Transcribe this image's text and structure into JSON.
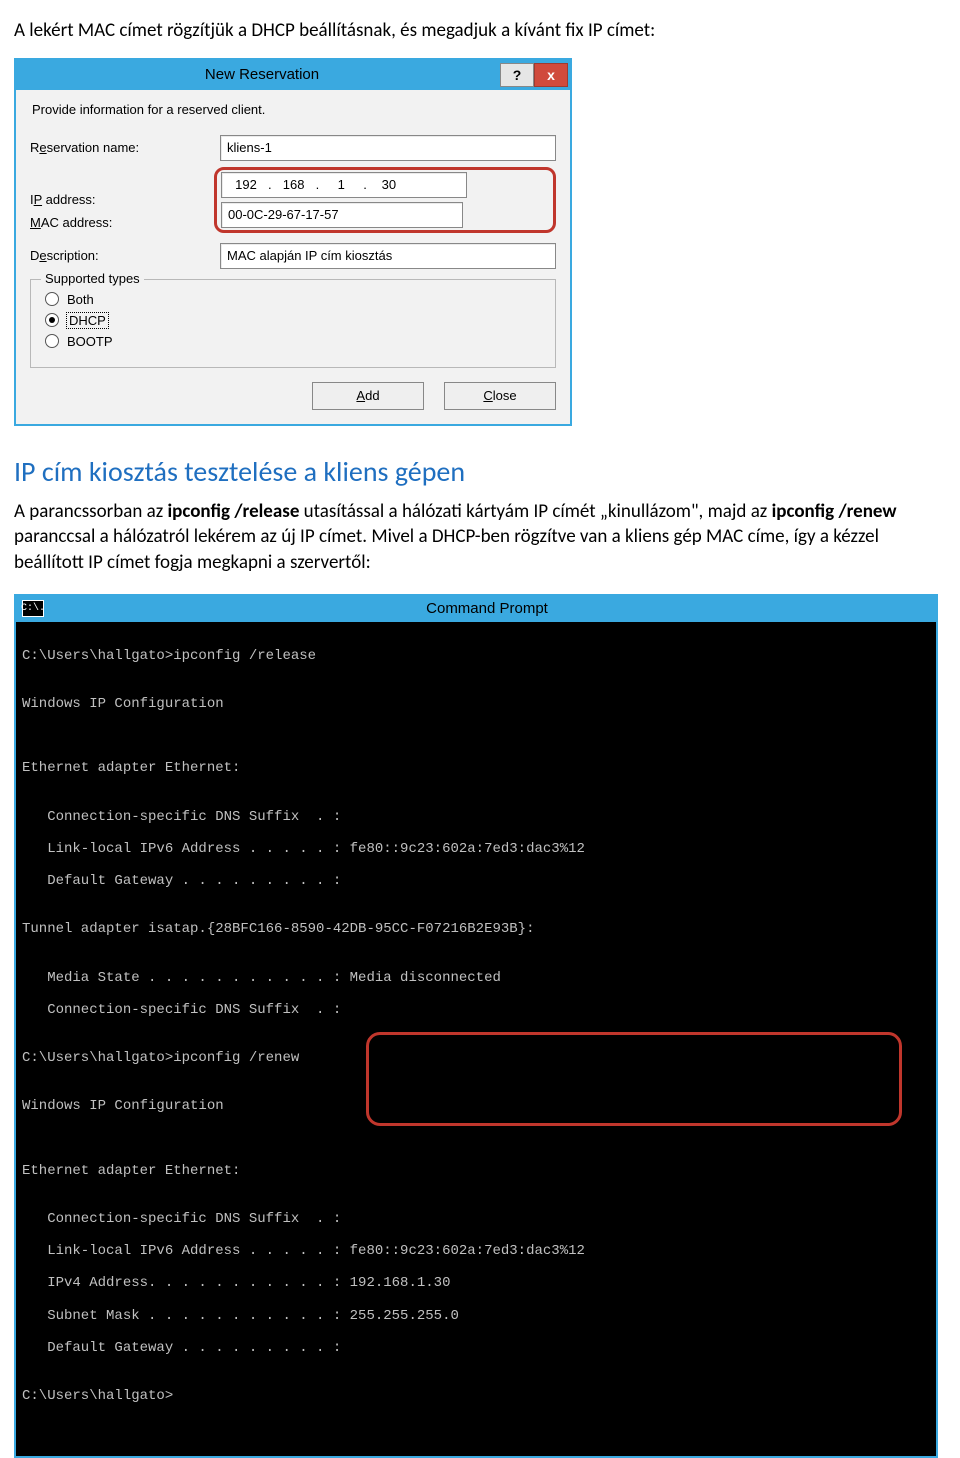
{
  "doc": {
    "intro_line": "A lekért MAC címet rögzítjük a DHCP beállításnak, és megadjuk a kívánt fix IP címet:",
    "heading": "IP cím kiosztás tesztelése a kliens gépen",
    "para_a": "A parancssorban az ",
    "para_b": "ipconfig /release",
    "para_c": " utasítással a hálózati kártyám IP címét „kinullázom\", majd az ",
    "para_d": "ipconfig /renew",
    "para_e": " paranccsal a hálózatról lekérem az új IP címet. Mivel a DHCP-ben rögzítve van a kliens gép MAC címe, így a kézzel beállított IP címet fogja megkapni a szervertől:"
  },
  "dlg": {
    "title": "New Reservation",
    "help": "?",
    "close": "x",
    "intro": "Provide information for a reserved client.",
    "lbl_name_pre": "R",
    "lbl_name_u": "e",
    "lbl_name_post": "servation name:",
    "lbl_ip_pre": "I",
    "lbl_ip_u": "P",
    "lbl_ip_post": " address:",
    "lbl_mac_pre": "",
    "lbl_mac_u": "M",
    "lbl_mac_post": "AC address:",
    "lbl_desc_pre": "D",
    "lbl_desc_u": "e",
    "lbl_desc_post": "scription:",
    "val_name": "kliens-1",
    "ip_o1": "192",
    "ip_o2": "168",
    "ip_o3": "1",
    "ip_o4": "30",
    "val_mac": "00-0C-29-67-17-57",
    "val_desc": "MAC alapján IP cím kiosztás",
    "legend": "Supported types",
    "rb_both_u": "B",
    "rb_both_post": "oth",
    "rb_dhcp_u": "D",
    "rb_dhcp_post": "HCP",
    "rb_bootp_pre": "B",
    "rb_bootp_u": "O",
    "rb_bootp_post": "OTP",
    "btn_add_u": "A",
    "btn_add_post": "dd",
    "btn_close_u": "C",
    "btn_close_post": "lose"
  },
  "cmd": {
    "title_icon": "C:\\.",
    "title": "Command Prompt",
    "l01": "C:\\Users\\hallgato>ipconfig /release",
    "l02": "",
    "l03": "Windows IP Configuration",
    "l04": "",
    "l05": "",
    "l06": "Ethernet adapter Ethernet:",
    "l07": "",
    "l08": "   Connection-specific DNS Suffix  . :",
    "l09": "   Link-local IPv6 Address . . . . . : fe80::9c23:602a:7ed3:dac3%12",
    "l10": "   Default Gateway . . . . . . . . . :",
    "l11": "",
    "l12": "Tunnel adapter isatap.{28BFC166-8590-42DB-95CC-F07216B2E93B}:",
    "l13": "",
    "l14": "   Media State . . . . . . . . . . . : Media disconnected",
    "l15": "   Connection-specific DNS Suffix  . :",
    "l16": "",
    "l17": "C:\\Users\\hallgato>ipconfig /renew",
    "l18": "",
    "l19": "Windows IP Configuration",
    "l20": "",
    "l21": "",
    "l22": "Ethernet adapter Ethernet:",
    "l23": "",
    "l24": "   Connection-specific DNS Suffix  . :",
    "l25": "   Link-local IPv6 Address . . . . . : fe80::9c23:602a:7ed3:dac3%12",
    "l26": "   IPv4 Address. . . . . . . . . . . : 192.168.1.30",
    "l27": "   Subnet Mask . . . . . . . . . . . : 255.255.255.0",
    "l28": "   Default Gateway . . . . . . . . . :",
    "l29": "",
    "l30": "C:\\Users\\hallgato>"
  }
}
